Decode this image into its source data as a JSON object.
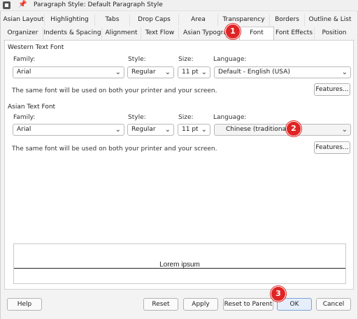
{
  "window": {
    "title": "Paragraph Style: Default Paragraph Style",
    "pin_icon": "pin-icon",
    "app_icon": "app-icon"
  },
  "tabs_row1": [
    {
      "label": "Asian Layout"
    },
    {
      "label": "Highlighting"
    },
    {
      "label": "Tabs"
    },
    {
      "label": "Drop Caps"
    },
    {
      "label": "Area"
    },
    {
      "label": "Transparency"
    },
    {
      "label": "Borders"
    },
    {
      "label": "Outline & List"
    }
  ],
  "tabs_row2": [
    {
      "label": "Organizer"
    },
    {
      "label": "Indents & Spacing"
    },
    {
      "label": "Alignment"
    },
    {
      "label": "Text Flow"
    },
    {
      "label": "Asian Typography"
    },
    {
      "label": "Font",
      "active": true
    },
    {
      "label": "Font Effects"
    },
    {
      "label": "Position"
    }
  ],
  "western": {
    "title": "Western Text Font",
    "family_label": "Family:",
    "family_value": "Arial",
    "style_label": "Style:",
    "style_value": "Regular",
    "size_label": "Size:",
    "size_value": "11 pt",
    "language_label": "Language:",
    "language_value": "Default - English (USA)",
    "note": "The same font will be used on both your printer and your screen.",
    "features_button": "Features..."
  },
  "asian": {
    "title": "Asian Text Font",
    "family_label": "Family:",
    "family_value": "Arial",
    "style_label": "Style:",
    "style_value": "Regular",
    "size_label": "Size:",
    "size_value": "11 pt",
    "language_label": "Language:",
    "language_value": "Chinese (traditional)",
    "note": "The same font will be used on both your printer and your screen.",
    "features_button": "Features..."
  },
  "preview": {
    "sample_text": "Lorem ipsum"
  },
  "buttons": {
    "help": "Help",
    "reset": "Reset",
    "apply": "Apply",
    "reset_to_parent": "Reset to Parent",
    "ok": "OK",
    "cancel": "Cancel"
  },
  "badges": [
    "1",
    "2",
    "3"
  ],
  "colors": {
    "badge": "#e02424",
    "ok_button": "#e5eefa"
  }
}
